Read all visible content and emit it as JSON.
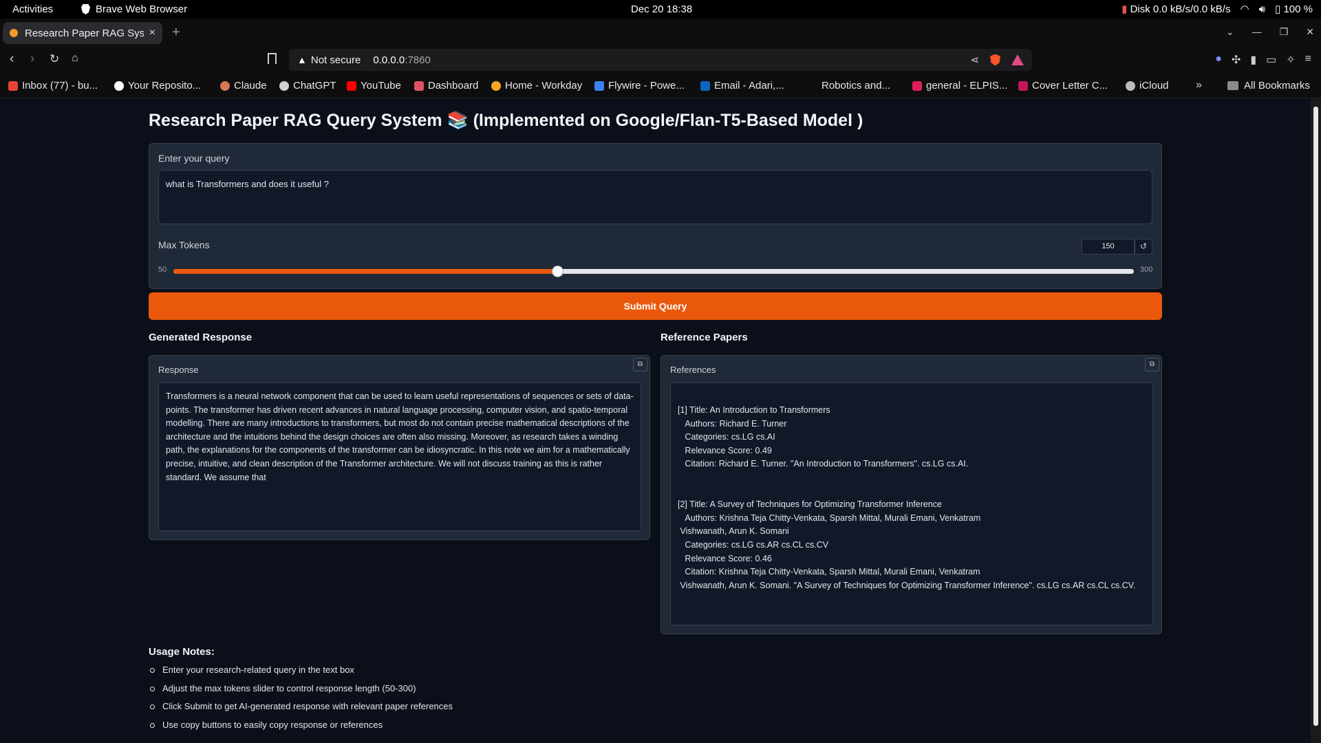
{
  "system_bar": {
    "activities": "Activities",
    "app_name": "Brave Web Browser",
    "clock": "Dec 20  18:38",
    "disk": "Disk 0.0 kB/s/0.0 kB/s",
    "battery": "100 %"
  },
  "browser": {
    "tab_title": "Research Paper RAG System",
    "url_warning": "Not secure",
    "url_host": "0.0.0.0",
    "url_port": ":7860",
    "bookmarks": [
      {
        "label": "Inbox (77) - bu...",
        "color": "#ea4335"
      },
      {
        "label": "Your Reposito...",
        "color": "#ffffff"
      },
      {
        "label": "Claude",
        "color": "#d97757"
      },
      {
        "label": "ChatGPT",
        "color": "#cfcfcf"
      },
      {
        "label": "YouTube",
        "color": "#ff0000"
      },
      {
        "label": "Dashboard",
        "color": "#e05263"
      },
      {
        "label": "Home - Workday",
        "color": "#f5a623"
      },
      {
        "label": "Flywire - Powe...",
        "color": "#3b82f6"
      },
      {
        "label": "Email - Adari,...",
        "color": "#0a66c2"
      },
      {
        "label": "Robotics and...",
        "color": "#0e0e0e"
      },
      {
        "label": "general - ELPIS...",
        "color": "#e01e5a"
      },
      {
        "label": "Cover Letter C...",
        "color": "#c2185b"
      },
      {
        "label": "iCloud",
        "color": "#bdbdbd"
      }
    ],
    "all_bookmarks": "All Bookmarks"
  },
  "app": {
    "title": "Research Paper RAG Query System 📚 (Implemented on Google/Flan-T5-Based Model )",
    "query_label": "Enter your query",
    "query_value": "what is Transformers and does it useful ?",
    "max_tokens_label": "Max Tokens",
    "slider_min": "50",
    "slider_max": "300",
    "max_tokens_value": "150",
    "max_tokens_fraction": 0.4,
    "submit_label": "Submit Query",
    "generated_title": "Generated Response",
    "response_label": "Response",
    "response_text": "Transformers is a neural network component that can be used to learn useful representations of sequences or sets of data-points. The transformer has driven recent advances in natural language processing, computer vision, and spatio-temporal modelling. There are many introductions to transformers, but most do not contain precise mathematical descriptions of the architecture and the intuitions behind the design choices are often also missing. Moreover, as research takes a winding path, the explanations for the components of the transformer can be idiosyncratic. In this note we aim for a mathematically precise, intuitive, and clean description of the Transformer architecture. We will not discuss training as this is rather standard. We assume that",
    "reference_title": "Reference Papers",
    "references_label": "References",
    "references_text": "[1] Title: An Introduction to Transformers\n   Authors: Richard E. Turner\n   Categories: cs.LG cs.AI\n   Relevance Score: 0.49\n   Citation: Richard E. Turner. \"An Introduction to Transformers\". cs.LG cs.AI.\n\n\n[2] Title: A Survey of Techniques for Optimizing Transformer Inference\n   Authors: Krishna Teja Chitty-Venkata, Sparsh Mittal, Murali Emani, Venkatram\n Vishwanath, Arun K. Somani\n   Categories: cs.LG cs.AR cs.CL cs.CV\n   Relevance Score: 0.46\n   Citation: Krishna Teja Chitty-Venkata, Sparsh Mittal, Murali Emani, Venkatram\n Vishwanath, Arun K. Somani. \"A Survey of Techniques for Optimizing Transformer Inference\". cs.LG cs.AR cs.CL cs.CV.",
    "usage_title": "Usage Notes:",
    "usage_notes": [
      "Enter your research-related query in the text box",
      "Adjust the max tokens slider to control response length (50-300)",
      "Click Submit to get AI-generated response with relevant paper references",
      "Use copy buttons to easily copy response or references"
    ]
  }
}
